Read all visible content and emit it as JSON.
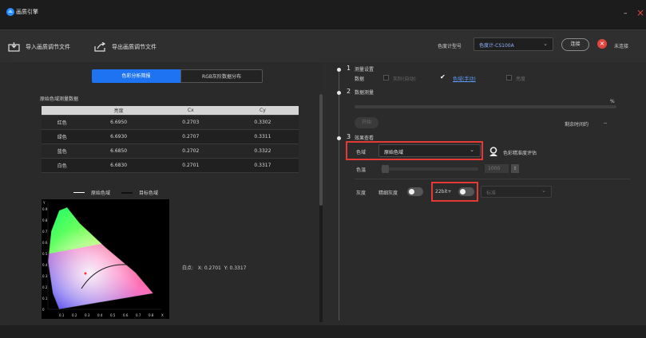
{
  "app": {
    "title": "画质引擎"
  },
  "toolbar": {
    "import_label": "导入画质调节文件",
    "export_label": "导出画质调节文件",
    "meter_model_label": "色度计型号",
    "meter_model_value": "色度计-CS100A",
    "connect_label": "连接",
    "status_text": "未连接"
  },
  "tabs": [
    {
      "label": "色彩分析简报",
      "active": true
    },
    {
      "label": "RGB灰阶数据分布",
      "active": false
    }
  ],
  "table": {
    "section_label": "原始色域测量数据",
    "headers": [
      "",
      "亮度",
      "Cx",
      "Cy"
    ],
    "rows": [
      [
        "红色",
        "6.6950",
        "0.2703",
        "0.3302"
      ],
      [
        "绿色",
        "6.6930",
        "0.2707",
        "0.3311"
      ],
      [
        "蓝色",
        "6.6850",
        "0.2702",
        "0.3322"
      ],
      [
        "白色",
        "6.6830",
        "0.2701",
        "0.3317"
      ]
    ]
  },
  "legend": {
    "original": "原始色域",
    "target": "目标色域"
  },
  "cie_chart": {
    "y_ticks": [
      "0.9",
      "0.8",
      "0.7",
      "0.6",
      "0.5",
      "0.4",
      "0.3",
      "0.2",
      "0.1",
      "0"
    ],
    "x_ticks": [
      "0.1",
      "0.2",
      "0.3",
      "0.4",
      "0.5",
      "0.6",
      "0.7",
      "0.8"
    ],
    "x_label": "X",
    "y_label": "Y"
  },
  "whitepoint": {
    "label": "白点:",
    "x_label": "X:",
    "x_value": "0.2701",
    "y_label": "Y:",
    "y_value": "0.3317"
  },
  "steps": {
    "s1": {
      "num": "1",
      "title": "测量设置",
      "data_label": "数据",
      "opt_gray_auto": "灰阶(自动)",
      "opt_gamut_manual": "色域(手动)",
      "opt_other": "亮度"
    },
    "s2": {
      "num": "2",
      "title": "数据测量",
      "percent": "%",
      "start_btn": "开始",
      "remaining_label": "剩余时间约",
      "remaining_value": "--"
    },
    "s3": {
      "num": "3",
      "title": "效果查看",
      "gamut_label": "色域",
      "gamut_value": "原始色域",
      "eval_label": "色彩精准度评估",
      "temp_label": "色温",
      "temp_value": "1000",
      "gray_label": "灰度",
      "fine_gray_label": "精细灰度",
      "bit_label": "22bit+",
      "mode_value": "标准"
    }
  },
  "colors": {
    "accent": "#1e73f2",
    "danger": "#e53935",
    "link": "#5f9bff"
  }
}
